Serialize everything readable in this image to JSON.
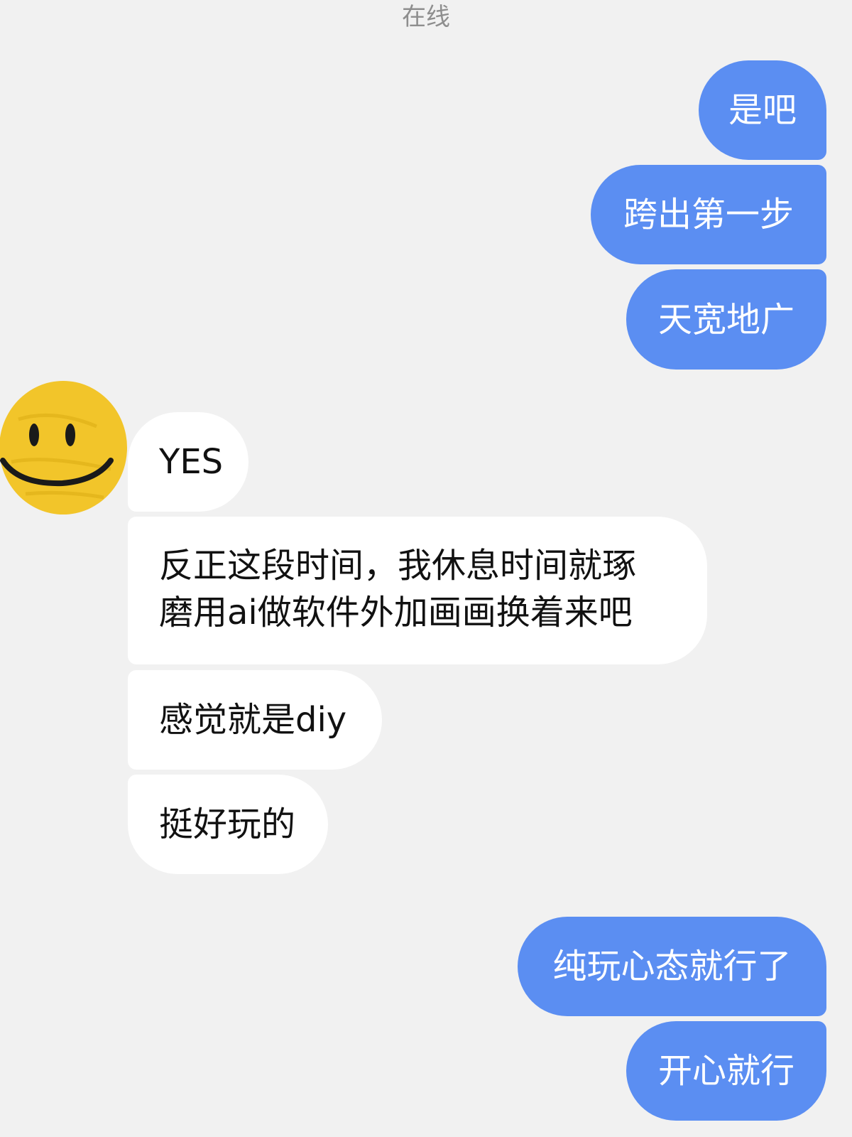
{
  "header": {
    "status": "在线"
  },
  "messages": [
    {
      "from": "me",
      "text": "是吧"
    },
    {
      "from": "me",
      "text": "跨出第一步"
    },
    {
      "from": "me",
      "text": "天宽地广"
    },
    {
      "from": "other",
      "text": "YES"
    },
    {
      "from": "other",
      "lines": [
        "反正这段时间，我休息时间就琢",
        "磨用ai做软件外加画画换着来吧"
      ]
    },
    {
      "from": "other",
      "text": "感觉就是diy"
    },
    {
      "from": "other",
      "text": "挺好玩的"
    },
    {
      "from": "me",
      "text": "纯玩心态就行了"
    },
    {
      "from": "me",
      "text": "开心就行"
    }
  ],
  "colors": {
    "background": "#f1f1f1",
    "outgoing_bubble": "#5b8ef2",
    "incoming_bubble": "#ffffff",
    "avatar": "#f2c52a"
  },
  "avatar": {
    "icon": "smiley-face-icon"
  }
}
